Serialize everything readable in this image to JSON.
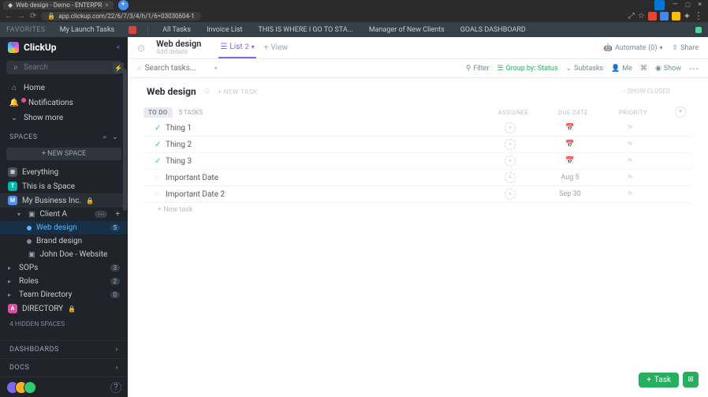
{
  "browser": {
    "tab_title": "Web design - Demo - ENTERPR",
    "url": "app.clickup.com/22/6/7/3/4/h/1/6=03030604-1"
  },
  "favorites": {
    "label": "FAVORITES",
    "items": [
      "My Launch Tasks"
    ],
    "pinned": [
      "All Tasks",
      "Invoice List",
      "THIS IS WHERE I GO TO STA...",
      "Manager of New Clients",
      "GOALS DASHBOARD"
    ]
  },
  "brand": "ClickUp",
  "sidebar": {
    "search_placeholder": "Search",
    "home": "Home",
    "notifications": "Notifications",
    "show_more": "Show more",
    "spaces_label": "SPACES",
    "new_space": "+  NEW SPACE",
    "everything": "Everything",
    "spaces": [
      {
        "letter": "T",
        "color": "#00b8a9",
        "name": "This is a Space"
      },
      {
        "letter": "M",
        "color": "#4f8ff7",
        "name": "My Business Inc.",
        "locked": true,
        "open": true,
        "folders": [
          {
            "name": "Client A",
            "open": true,
            "children": [
              {
                "name": "Web design",
                "count": 5,
                "selected": true
              },
              {
                "name": "Brand design"
              }
            ]
          },
          {
            "name": "John Doe - Website"
          }
        ]
      }
    ],
    "items_after": [
      {
        "name": "SOPs",
        "badge": "3"
      },
      {
        "name": "Roles",
        "badge": "2"
      },
      {
        "name": "Team Directory",
        "badge": "0"
      }
    ],
    "directory": {
      "letter": "A",
      "color": "#d8509f",
      "name": "DIRECTORY",
      "locked": true
    },
    "hidden": "4 HIDDEN SPACES",
    "dashboards": "DASHBOARDS",
    "docs": "DOCS"
  },
  "header": {
    "title": "Web design",
    "subtitle": "Add details",
    "tab_list": "List",
    "tab_badge": "2",
    "tab_view": "View",
    "automate": "Automate",
    "automate_count": "(0)",
    "share": "Share"
  },
  "toolbar": {
    "search_placeholder": "Search tasks...",
    "filter": "Filter",
    "group": "Group by: Status",
    "subtasks": "Subtasks",
    "me": "Me",
    "show": "Show"
  },
  "list": {
    "title": "Web design",
    "new_task": "+ NEW TASK",
    "show_closed": "⎯ SHOW CLOSED",
    "group_status": "TO DO",
    "group_count": "5 TASKS",
    "columns": {
      "assignee": "ASSIGNEE",
      "due": "DUE DATE",
      "priority": "PRIORITY"
    },
    "tasks": [
      {
        "name": "Thing 1",
        "done": true,
        "due": ""
      },
      {
        "name": "Thing 2",
        "done": true,
        "due": ""
      },
      {
        "name": "Thing 3",
        "done": true,
        "due": ""
      },
      {
        "name": "Important Date",
        "done": false,
        "due": "Aug 5"
      },
      {
        "name": "Important Date 2",
        "done": false,
        "due": "Sep 30"
      }
    ],
    "add_new": "+ New task"
  },
  "fab": {
    "label": "Task"
  }
}
